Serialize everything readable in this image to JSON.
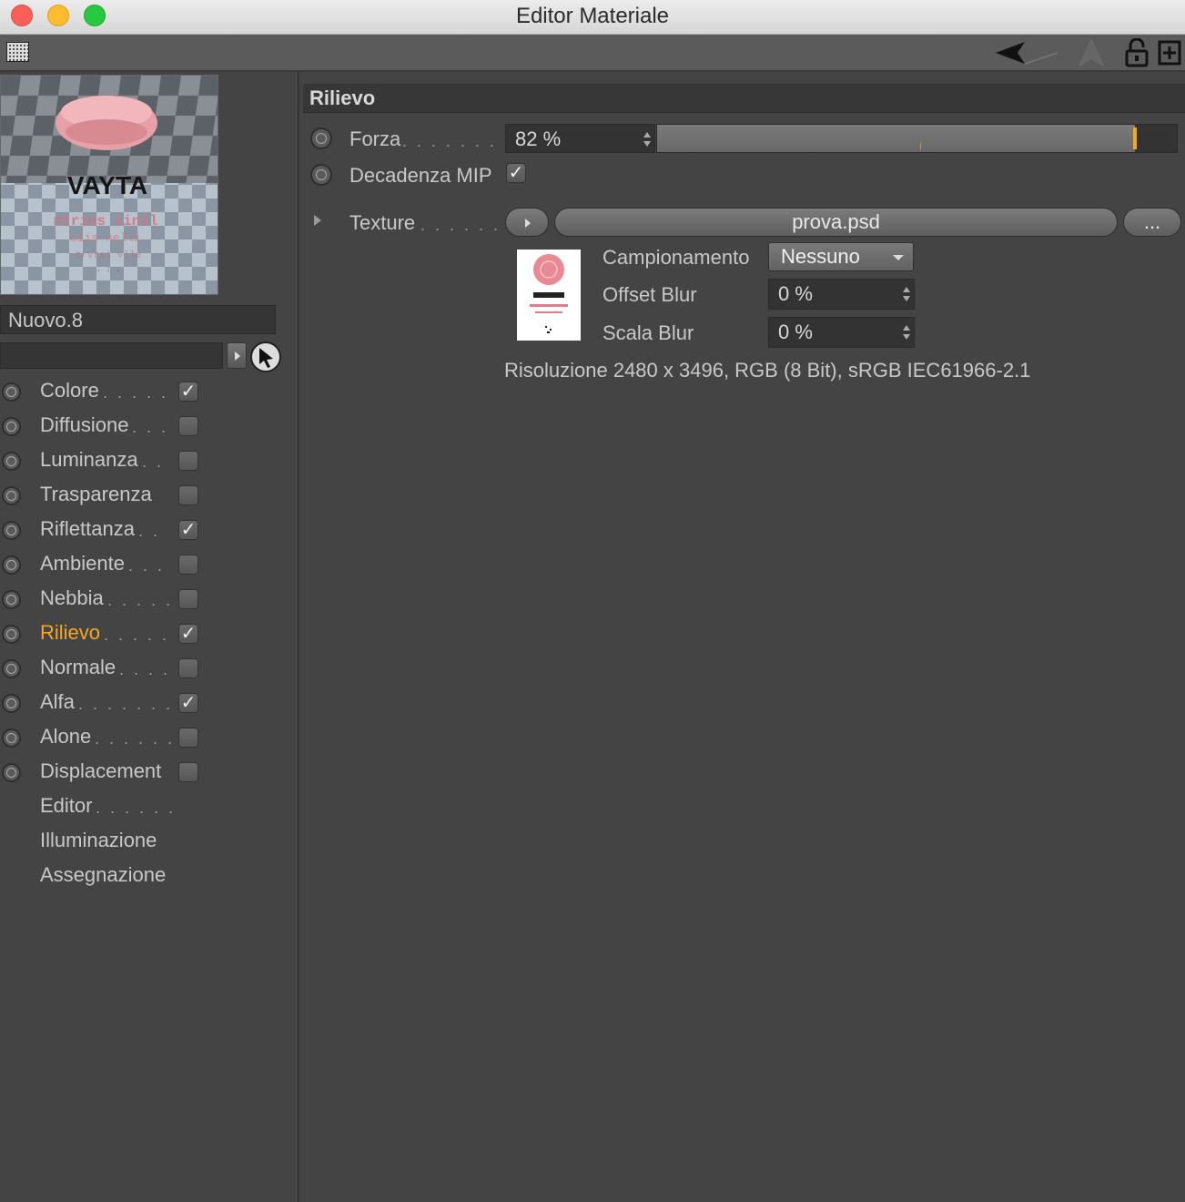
{
  "window": {
    "title": "Editor Materiale"
  },
  "material": {
    "name": "Nuovo.8",
    "search_value": ""
  },
  "channels": [
    {
      "label": "Colore",
      "dots": ". . . . . .",
      "checked": true,
      "active": false,
      "has_radio": true,
      "has_check": true
    },
    {
      "label": "Diffusione",
      "dots": ". . .",
      "checked": false,
      "active": false,
      "has_radio": true,
      "has_check": true
    },
    {
      "label": "Luminanza",
      "dots": ". .",
      "checked": false,
      "active": false,
      "has_radio": true,
      "has_check": true
    },
    {
      "label": "Trasparenza",
      "dots": "",
      "checked": false,
      "active": false,
      "has_radio": true,
      "has_check": true
    },
    {
      "label": "Riflettanza",
      "dots": ". .",
      "checked": true,
      "active": false,
      "has_radio": true,
      "has_check": true
    },
    {
      "label": "Ambiente",
      "dots": ". . .",
      "checked": false,
      "active": false,
      "has_radio": true,
      "has_check": true
    },
    {
      "label": "Nebbia",
      "dots": ". . . . .",
      "checked": false,
      "active": false,
      "has_radio": true,
      "has_check": true
    },
    {
      "label": "Rilievo",
      "dots": ". . . . . .",
      "checked": true,
      "active": true,
      "has_radio": true,
      "has_check": true
    },
    {
      "label": "Normale",
      "dots": ". . . .",
      "checked": false,
      "active": false,
      "has_radio": true,
      "has_check": true
    },
    {
      "label": "Alfa",
      "dots": ". . . . . . . .",
      "checked": true,
      "active": false,
      "has_radio": true,
      "has_check": true
    },
    {
      "label": "Alone",
      "dots": ". . . . . .",
      "checked": false,
      "active": false,
      "has_radio": true,
      "has_check": true
    },
    {
      "label": "Displacement",
      "dots": "",
      "checked": false,
      "active": false,
      "has_radio": true,
      "has_check": true
    },
    {
      "label": "Editor",
      "dots": ". . . . . .",
      "checked": false,
      "active": false,
      "has_radio": false,
      "has_check": false
    },
    {
      "label": "Illuminazione",
      "dots": "",
      "checked": false,
      "active": false,
      "has_radio": false,
      "has_check": false
    },
    {
      "label": "Assegnazione",
      "dots": "",
      "checked": false,
      "active": false,
      "has_radio": false,
      "has_check": false
    }
  ],
  "section": {
    "title": "Rilievo",
    "forza": {
      "label": "Forza",
      "dots": ". . . . . . . . . .",
      "value": "82 %",
      "slider_fraction": 0.92
    },
    "decadenza": {
      "label": "Decadenza MIP",
      "checked": true
    },
    "texture": {
      "label": "Texture",
      "dots": ". . . . . . . .",
      "file": "prova.psd",
      "more_label": "..."
    },
    "campionamento": {
      "label": "Campionamento",
      "value": "Nessuno"
    },
    "offset_blur": {
      "label": "Offset Blur",
      "value": "0 %"
    },
    "scala_blur": {
      "label": "Scala Blur",
      "value": "0 %"
    },
    "info": "Risoluzione 2480 x 3496, RGB (8 Bit), sRGB IEC61966-2.1"
  },
  "colors": {
    "accent": "#f5a623",
    "background": "#444444",
    "field": "#333333"
  },
  "icons": [
    "close-button",
    "minimize-button",
    "maximize-button",
    "grid-icon",
    "back-arrow-icon",
    "up-arrow-icon",
    "lock-icon",
    "new-window-icon",
    "picker-icon",
    "play-icon"
  ]
}
